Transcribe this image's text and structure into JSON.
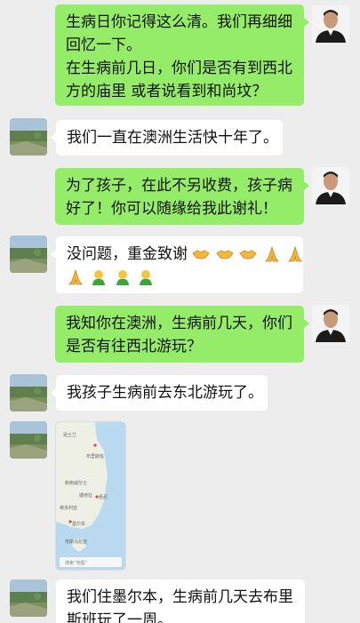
{
  "messages": [
    {
      "side": "me",
      "lines": [
        "生病日你记得这么清。我们再细细",
        "回忆一下。",
        "在生病前几日，你们是否有到西北",
        "方的庙里 或者说看到和尚坟？"
      ]
    },
    {
      "side": "other",
      "lines": [
        "我们一直在澳洲生活快十年了。"
      ]
    },
    {
      "side": "me",
      "lines": [
        "为了孩子，在此不另收费，孩子病",
        "好了！你可以随缘给我此谢礼！"
      ]
    },
    {
      "side": "other",
      "lines": [
        "没问题，重金致谢"
      ],
      "emoji_line1": [
        "handshake",
        "handshake",
        "handshake",
        "pray",
        "pray"
      ],
      "emoji_line2": [
        "pray",
        "person",
        "person",
        "person"
      ]
    },
    {
      "side": "me",
      "lines": [
        "我知你在澳洲，生病前几天，你们",
        "是否有往西北游玩？"
      ]
    },
    {
      "side": "other",
      "lines": [
        "我孩子生病前去东北游玩了。"
      ]
    },
    {
      "side": "other",
      "type": "map",
      "map": {
        "labels": [
          "堪培拉",
          "新南威尔士",
          "布里斯班",
          "悉尼",
          "维多利亚",
          "墨尔本",
          "塔斯马尼亚",
          "昆士兰"
        ],
        "search_placeholder": "搜索“地图”"
      }
    },
    {
      "side": "other",
      "lines": [
        "我们住墨尔本，生病前几天去布里",
        "斯班玩了一周。"
      ]
    }
  ],
  "colors": {
    "me_bubble": "#95ec69",
    "other_bubble": "#ffffff",
    "background": "#ededed"
  },
  "icons": {
    "emoji_handshake": "handshake-emoji",
    "emoji_pray": "pray-emoji",
    "emoji_person": "person-emoji"
  }
}
